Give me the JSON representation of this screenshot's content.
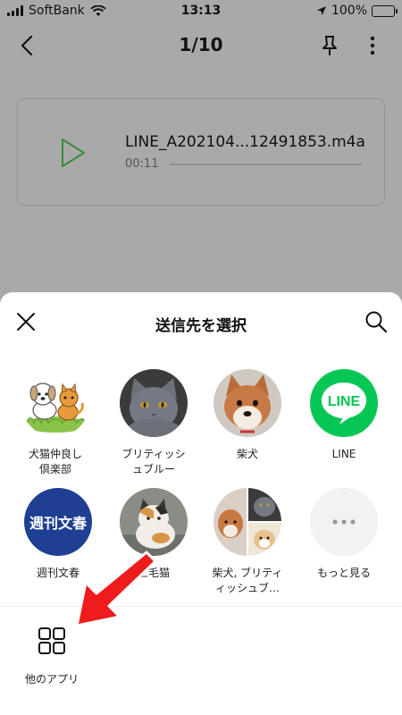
{
  "status_bar": {
    "carrier": "SoftBank",
    "time": "13:13",
    "battery": "100%"
  },
  "header": {
    "page_counter": "1/10"
  },
  "audio": {
    "file_name": "LINE_A202104...12491853.m4a",
    "duration": "00:11",
    "progress": 0
  },
  "share_sheet": {
    "title": "送信先を選択",
    "contacts": [
      {
        "label": "犬猫仲良し\n倶楽部"
      },
      {
        "label": "ブリティッシ\nュブルー"
      },
      {
        "label": "柴犬"
      },
      {
        "label": "LINE",
        "logo_text": "LINE"
      },
      {
        "label": "週刊文春",
        "logo_text": "週刊文春"
      },
      {
        "label": "三毛猫"
      },
      {
        "label": "柴犬, ブリティ\nィッシュブ…"
      },
      {
        "label": "もっと見る"
      }
    ],
    "other_apps_label": "他のアプリ"
  },
  "colors": {
    "line_green": "#06c755",
    "play_green": "#3a8a3a",
    "annotation_red": "#ee1c1c",
    "bunshun_blue": "#1f3f93"
  }
}
